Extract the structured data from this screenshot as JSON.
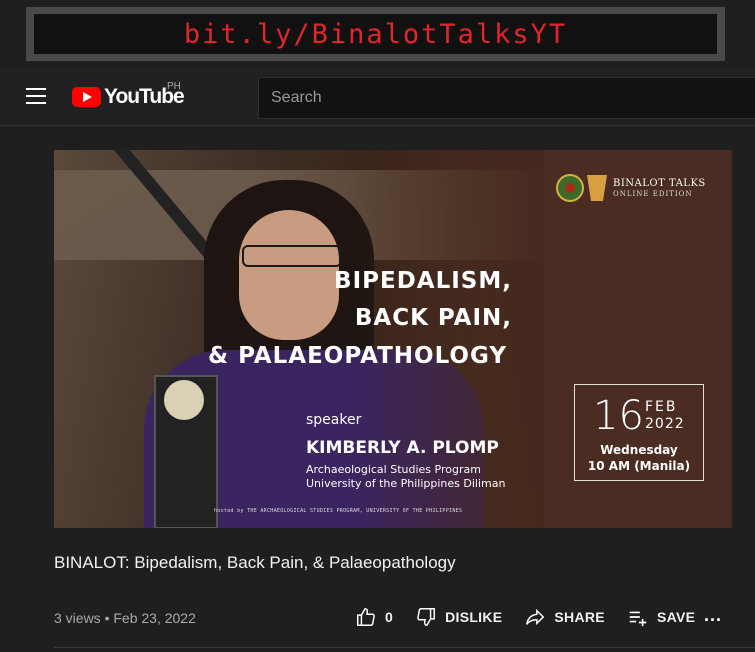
{
  "banner": {
    "text": "bit.ly/BinalotTalksYT"
  },
  "header": {
    "logo_text": "YouTube",
    "country_code": "PH",
    "search_placeholder": "Search"
  },
  "thumbnail": {
    "brand_title": "BINALOT TALKS",
    "brand_subtitle": "ONLINE EDITION",
    "title_lines": [
      "BIPEDALISM,",
      "BACK PAIN,",
      "& PALAEOPATHOLOGY"
    ],
    "speaker_label": "speaker",
    "speaker_name": "KIMBERLY A. PLOMP",
    "affiliation_1": "Archaeological Studies Program",
    "affiliation_2": "University of the Philippines Diliman",
    "hosted_by": "hosted by THE ARCHAEOLOGICAL STUDIES PROGRAM, UNIVERSITY OF THE PHILIPPINES",
    "date_day": "16",
    "date_month": "FEB",
    "date_year": "2022",
    "date_weekday": "Wednesday",
    "date_time": "10 AM (Manila)"
  },
  "video": {
    "title": "BINALOT: Bipedalism, Back Pain, & Palaeopathology",
    "meta": "3 views • Feb 23, 2022"
  },
  "actions": {
    "like_count": "0",
    "dislike_label": "DISLIKE",
    "share_label": "SHARE",
    "save_label": "SAVE",
    "more_label": "..."
  },
  "icons": [
    "menu-icon",
    "youtube-logo-icon",
    "like-icon",
    "dislike-icon",
    "share-icon",
    "save-icon",
    "more-icon"
  ]
}
